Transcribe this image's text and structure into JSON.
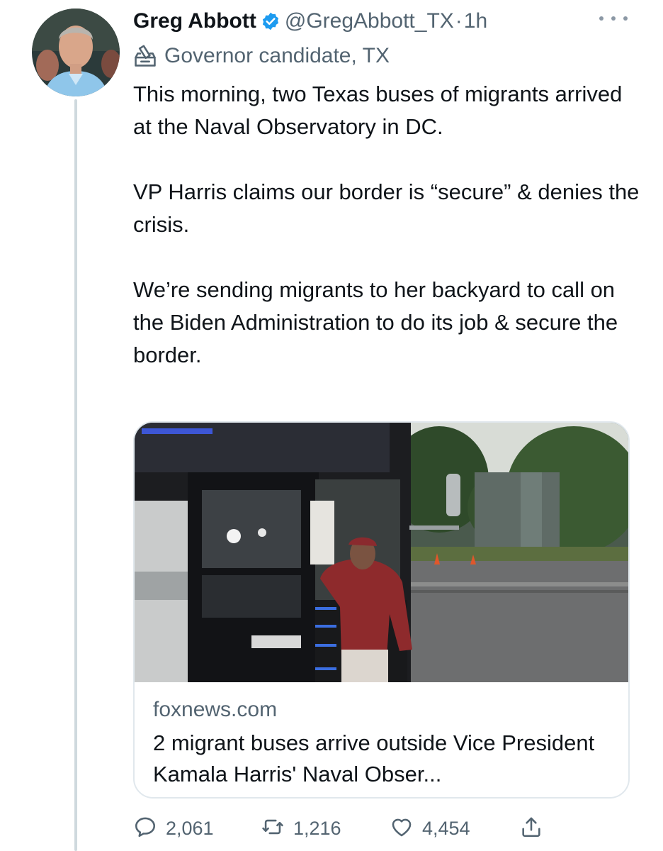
{
  "tweet": {
    "author_name": "Greg Abbott",
    "handle": "@GregAbbott_TX",
    "separator": "·",
    "time": "1h",
    "label": "Governor candidate, TX",
    "paragraphs": [
      "This morning, two Texas buses of migrants arrived at the Naval Observatory in DC.",
      "VP Harris claims our border is “secure” & denies the crisis.",
      "We’re sending migrants to her backyard to call on the Biden Administration to do its job & secure the border."
    ]
  },
  "card": {
    "domain": "foxnews.com",
    "title": "2 migrant buses arrive outside Vice President Kamala Harris' Naval Obser..."
  },
  "actions": {
    "replies": "2,061",
    "retweets": "1,216",
    "likes": "4,454"
  },
  "icons": {
    "verified": "verified-badge-icon",
    "label": "ballot-box-icon",
    "more": "more-options-icon",
    "reply": "reply-icon",
    "retweet": "retweet-icon",
    "like": "heart-icon",
    "share": "share-icon"
  },
  "colors": {
    "verified_blue": "#1d9bf0",
    "secondary_text": "#536471",
    "thread_line": "#cfd9de"
  }
}
